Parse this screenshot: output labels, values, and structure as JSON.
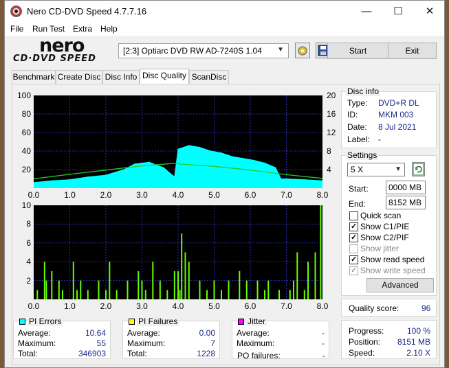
{
  "window": {
    "title": "Nero CD-DVD Speed 4.7.7.16",
    "minimize": "—",
    "maximize": "☐",
    "close": "✕"
  },
  "menu": [
    "File",
    "Run Test",
    "Extra",
    "Help"
  ],
  "logo": {
    "brand": "nero",
    "product": "CD·DVD SPEED"
  },
  "toolbar": {
    "drive": "[2:3]   Optiarc DVD RW AD-7240S 1.04",
    "start_label": "Start",
    "exit_label": "Exit"
  },
  "tabs": [
    "Benchmark",
    "Create Disc",
    "Disc Info",
    "Disc Quality",
    "ScanDisc"
  ],
  "active_tab": "Disc Quality",
  "disc_info": {
    "title": "Disc info",
    "type_label": "Type:",
    "type": "DVD+R DL",
    "id_label": "ID:",
    "id": "MKM 003",
    "date_label": "Date:",
    "date": "8 Jul 2021",
    "label_label": "Label:",
    "label": "-"
  },
  "settings": {
    "title": "Settings",
    "speed": "5 X",
    "start_label": "Start:",
    "start": "0000 MB",
    "end_label": "End:",
    "end": "8152 MB",
    "quick_scan": "Quick scan",
    "show_c1": "Show C1/PIE",
    "show_c2": "Show C2/PIF",
    "show_jitter": "Show jitter",
    "show_read": "Show read speed",
    "show_write": "Show write speed",
    "advanced": "Advanced"
  },
  "quality": {
    "label": "Quality score:",
    "value": "96"
  },
  "progress": {
    "progress_label": "Progress:",
    "progress": "100 %",
    "position_label": "Position:",
    "position": "8151 MB",
    "speed_label": "Speed:",
    "speed": "2.10 X"
  },
  "pi_errors": {
    "title": "PI Errors",
    "avg_label": "Average:",
    "avg": "10.64",
    "max_label": "Maximum:",
    "max": "55",
    "total_label": "Total:",
    "total": "346903",
    "color": "#00ffff"
  },
  "pi_failures": {
    "title": "PI Failures",
    "avg_label": "Average:",
    "avg": "0.00",
    "max_label": "Maximum:",
    "max": "7",
    "total_label": "Total:",
    "total": "1228",
    "color": "#ffff00"
  },
  "jitter": {
    "title": "Jitter",
    "avg_label": "Average:",
    "avg": "-",
    "max_label": "Maximum:",
    "max": "-",
    "po_label": "PO failures:",
    "po": "-",
    "color": "#ff00ff"
  },
  "chart_data": [
    {
      "type": "area",
      "xlim": [
        0,
        8
      ],
      "ylim_left": [
        0,
        100
      ],
      "ylim_right": [
        0,
        20
      ],
      "xticks": [
        "0.0",
        "1.0",
        "2.0",
        "3.0",
        "4.0",
        "5.0",
        "6.0",
        "7.0",
        "8.0"
      ],
      "yticks_left": [
        "100",
        "80",
        "60",
        "40",
        "20"
      ],
      "yticks_right": [
        "20",
        "16",
        "12",
        "8",
        "4"
      ],
      "series": [
        {
          "name": "PI Errors",
          "color": "#00ffff",
          "x": [
            0.0,
            0.5,
            1.0,
            1.5,
            2.0,
            2.5,
            2.8,
            3.2,
            3.6,
            3.9,
            4.0,
            4.3,
            4.6,
            4.9,
            5.2,
            5.5,
            5.8,
            6.1,
            6.4,
            6.7,
            6.85,
            7.0,
            7.5,
            8.0
          ],
          "y": [
            6,
            8,
            9,
            12,
            14,
            20,
            26,
            28,
            22,
            12,
            42,
            46,
            44,
            40,
            38,
            34,
            32,
            30,
            27,
            22,
            10,
            10,
            9,
            8
          ]
        },
        {
          "name": "Read speed",
          "color": "#22cc22",
          "x": [
            0.0,
            1.0,
            2.0,
            3.0,
            4.0,
            4.05,
            5.0,
            6.0,
            7.0,
            8.0
          ],
          "y": [
            2.0,
            3.0,
            3.9,
            4.8,
            5.4,
            5.2,
            4.7,
            3.9,
            2.9,
            2.1
          ]
        }
      ]
    },
    {
      "type": "bar",
      "xlim": [
        0,
        8
      ],
      "ylim": [
        0,
        10
      ],
      "xticks": [
        "0.0",
        "1.0",
        "2.0",
        "3.0",
        "4.0",
        "5.0",
        "6.0",
        "7.0",
        "8.0"
      ],
      "yticks": [
        "10",
        "8",
        "6",
        "4",
        "2"
      ],
      "series": [
        {
          "name": "PI Failures",
          "color": "#66ff00",
          "x": [
            0.1,
            0.3,
            0.35,
            0.5,
            0.7,
            0.8,
            1.1,
            1.2,
            1.3,
            1.5,
            1.8,
            2.0,
            2.1,
            2.3,
            2.6,
            2.9,
            3.0,
            3.1,
            3.3,
            3.5,
            3.7,
            3.9,
            4.0,
            4.05,
            4.1,
            4.2,
            4.3,
            4.6,
            4.8,
            5.0,
            5.2,
            5.4,
            5.7,
            5.9,
            6.2,
            6.4,
            6.5,
            6.8,
            7.1,
            7.2,
            7.3,
            7.5,
            7.6,
            7.8,
            7.95
          ],
          "y": [
            1,
            4,
            2,
            3,
            2,
            1,
            4,
            1,
            2,
            1,
            2,
            1,
            4,
            1,
            2,
            3,
            2,
            1,
            4,
            2,
            1,
            3,
            3,
            1,
            7,
            5,
            4,
            2,
            1,
            2,
            1,
            2,
            3,
            2,
            2,
            1,
            2,
            1,
            1,
            2,
            5,
            1,
            4,
            5,
            10
          ]
        }
      ]
    }
  ]
}
